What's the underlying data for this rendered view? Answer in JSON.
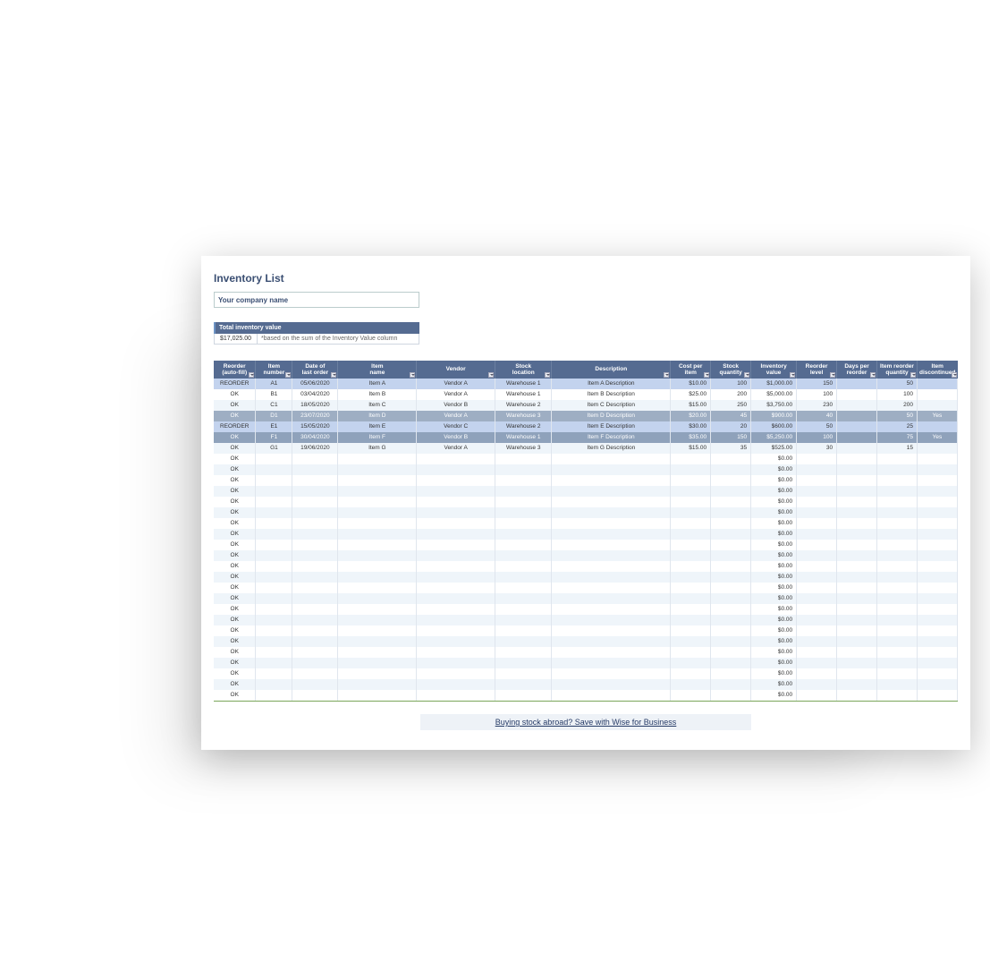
{
  "title": "Inventory List",
  "company_placeholder": "Your company name",
  "total_label": "Total inventory value",
  "total_value": "$17,025.00",
  "total_note": "*based on the sum of the Inventory Value column",
  "columns": [
    "Reorder (auto-fill)",
    "Item number",
    "Date of last order",
    "Item name",
    "Vendor",
    "Stock location",
    "Description",
    "Cost per item",
    "Stock quantity",
    "Inventory value",
    "Reorder level",
    "Days per reorder",
    "Item reorder quantity",
    "Item discontinued"
  ],
  "rows": [
    {
      "cls": "reorder",
      "r": [
        "REORDER",
        "A1",
        "05/06/2020",
        "Item A",
        "Vendor A",
        "Warehouse 1",
        "Item A Description",
        "$10.00",
        "100",
        "$1,000.00",
        "150",
        "",
        "50",
        ""
      ]
    },
    {
      "cls": "odd",
      "r": [
        "OK",
        "B1",
        "03/04/2020",
        "Item B",
        "Vendor A",
        "Warehouse 1",
        "Item B Description",
        "$25.00",
        "200",
        "$5,000.00",
        "100",
        "",
        "100",
        ""
      ]
    },
    {
      "cls": "even",
      "r": [
        "OK",
        "C1",
        "18/05/2020",
        "Item C",
        "Vendor B",
        "Warehouse 2",
        "Item C Description",
        "$15.00",
        "250",
        "$3,750.00",
        "230",
        "",
        "200",
        ""
      ]
    },
    {
      "cls": "disc",
      "r": [
        "OK",
        "D1",
        "23/07/2020",
        "Item D",
        "Vendor A",
        "Warehouse 3",
        "Item D Description",
        "$20.00",
        "45",
        "$900.00",
        "40",
        "",
        "50",
        "Yes"
      ]
    },
    {
      "cls": "reorder",
      "r": [
        "REORDER",
        "E1",
        "15/05/2020",
        "Item E",
        "Vendor C",
        "Warehouse 2",
        "Item E Description",
        "$30.00",
        "20",
        "$600.00",
        "50",
        "",
        "25",
        ""
      ]
    },
    {
      "cls": "disc2",
      "r": [
        "OK",
        "F1",
        "30/04/2020",
        "Item F",
        "Vendor B",
        "Warehouse 1",
        "Item F Description",
        "$35.00",
        "150",
        "$5,250.00",
        "100",
        "",
        "75",
        "Yes"
      ]
    },
    {
      "cls": "even",
      "r": [
        "OK",
        "G1",
        "19/06/2020",
        "Item G",
        "Vendor A",
        "Warehouse 3",
        "Item G Description",
        "$15.00",
        "35",
        "$525.00",
        "30",
        "",
        "15",
        ""
      ]
    }
  ],
  "blank_count": 23,
  "wise_text": "Buying stock abroad? Save with Wise for Business",
  "chart_data": {
    "type": "table",
    "title": "Inventory List",
    "columns": [
      "Reorder (auto-fill)",
      "Item number",
      "Date of last order",
      "Item name",
      "Vendor",
      "Stock location",
      "Description",
      "Cost per item",
      "Stock quantity",
      "Inventory value",
      "Reorder level",
      "Days per reorder",
      "Item reorder quantity",
      "Item discontinued"
    ],
    "data": [
      [
        "REORDER",
        "A1",
        "05/06/2020",
        "Item A",
        "Vendor A",
        "Warehouse 1",
        "Item A Description",
        10.0,
        100,
        1000.0,
        150,
        null,
        50,
        null
      ],
      [
        "OK",
        "B1",
        "03/04/2020",
        "Item B",
        "Vendor A",
        "Warehouse 1",
        "Item B Description",
        25.0,
        200,
        5000.0,
        100,
        null,
        100,
        null
      ],
      [
        "OK",
        "C1",
        "18/05/2020",
        "Item C",
        "Vendor B",
        "Warehouse 2",
        "Item C Description",
        15.0,
        250,
        3750.0,
        230,
        null,
        200,
        null
      ],
      [
        "OK",
        "D1",
        "23/07/2020",
        "Item D",
        "Vendor A",
        "Warehouse 3",
        "Item D Description",
        20.0,
        45,
        900.0,
        40,
        null,
        50,
        "Yes"
      ],
      [
        "REORDER",
        "E1",
        "15/05/2020",
        "Item E",
        "Vendor C",
        "Warehouse 2",
        "Item E Description",
        30.0,
        20,
        600.0,
        50,
        null,
        25,
        null
      ],
      [
        "OK",
        "F1",
        "30/04/2020",
        "Item F",
        "Vendor B",
        "Warehouse 1",
        "Item F Description",
        35.0,
        150,
        5250.0,
        100,
        null,
        75,
        "Yes"
      ],
      [
        "OK",
        "G1",
        "19/06/2020",
        "Item G",
        "Vendor A",
        "Warehouse 3",
        "Item G Description",
        15.0,
        35,
        525.0,
        30,
        null,
        15,
        null
      ]
    ],
    "total_inventory_value": 17025.0
  }
}
